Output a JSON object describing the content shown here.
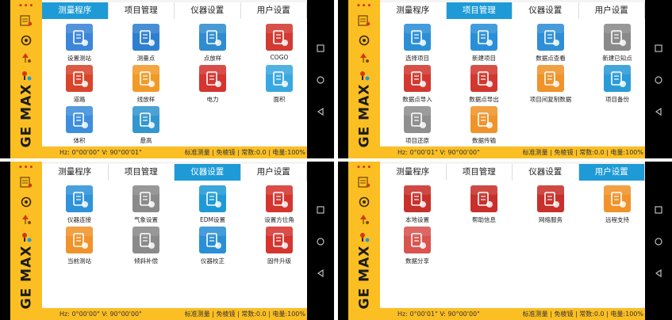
{
  "colors": {
    "accent": "#1e9bd7",
    "sidebar": "#fbbf24",
    "statusbar": "#fbbf24"
  },
  "sidebar": {
    "dots": "•••",
    "logo": "GE MAX"
  },
  "tabs": [
    "测量程序",
    "项目管理",
    "仪器设置",
    "用户设置"
  ],
  "status": {
    "right": "标准测量 | 免棱镜 | 常数:0.0 | 电量:100%",
    "hz_v_a": "Hz: 0°00'00\"  V: 90°00'01\"",
    "hz_v_b": "Hz: 0°00'01\"  V: 90°00'00\"",
    "hz_v_c": "Hz: 0°00'00\"  V: 90°00'00\"",
    "hz_v_d": "Hz: 0°00'01\"  V: 90°00'00\""
  },
  "panels": [
    {
      "active_tab": 0,
      "items": [
        {
          "label": "设置测站",
          "icon": "station-setup-icon",
          "color": "#3b86d8"
        },
        {
          "label": "测量点",
          "icon": "measure-point-icon",
          "color": "#2f7fd0"
        },
        {
          "label": "点放样",
          "icon": "point-stakeout-icon",
          "color": "#2f8ccf"
        },
        {
          "label": "COGO",
          "icon": "cogo-icon",
          "color": "#d23a32"
        },
        {
          "label": "道路",
          "icon": "road-icon",
          "color": "#d8452b"
        },
        {
          "label": "线放样",
          "icon": "line-stakeout-icon",
          "color": "#f29a27"
        },
        {
          "label": "电力",
          "icon": "power-icon",
          "color": "#d5342f"
        },
        {
          "label": "面积",
          "icon": "area-icon",
          "color": "#39a7e0"
        },
        {
          "label": "体积",
          "icon": "volume-icon",
          "color": "#3d8edb"
        },
        {
          "label": "悬高",
          "icon": "remote-height-icon",
          "color": "#3396cf"
        }
      ]
    },
    {
      "active_tab": 1,
      "items": [
        {
          "label": "选择项目",
          "icon": "select-project-icon",
          "color": "#2b8fd6"
        },
        {
          "label": "新建项目",
          "icon": "new-project-icon",
          "color": "#2a8fd8"
        },
        {
          "label": "数据点查看",
          "icon": "view-points-icon",
          "color": "#2e8ed6"
        },
        {
          "label": "新建已知点",
          "icon": "new-known-point-icon",
          "color": "#8a8a8a"
        },
        {
          "label": "数据点导入",
          "icon": "import-points-icon",
          "color": "#d2382f"
        },
        {
          "label": "数据点导出",
          "icon": "export-points-icon",
          "color": "#d2382f"
        },
        {
          "label": "项目间复制数据",
          "icon": "copy-data-icon",
          "color": "#f0932a"
        },
        {
          "label": "项目备份",
          "icon": "project-backup-icon",
          "color": "#2b9bd8"
        },
        {
          "label": "项目还原",
          "icon": "project-restore-icon",
          "color": "#8f8f8f"
        },
        {
          "label": "数据传输",
          "icon": "data-transfer-icon",
          "color": "#f0932a"
        }
      ]
    },
    {
      "active_tab": 2,
      "items": [
        {
          "label": "仪器连接",
          "icon": "instrument-connect-icon",
          "color": "#2e93d8"
        },
        {
          "label": "气象设置",
          "icon": "weather-settings-icon",
          "color": "#8a8a8a"
        },
        {
          "label": "EDM设置",
          "icon": "edm-settings-icon",
          "color": "#1f9ad6"
        },
        {
          "label": "设置方位角",
          "icon": "azimuth-icon",
          "color": "#d5352f"
        },
        {
          "label": "当前测站",
          "icon": "current-station-icon",
          "color": "#f0932a"
        },
        {
          "label": "倾斜补偿",
          "icon": "tilt-compensation-icon",
          "color": "#8a8a8a"
        },
        {
          "label": "仪器校正",
          "icon": "calibration-icon",
          "color": "#2b8fd6"
        },
        {
          "label": "固件升级",
          "icon": "firmware-upgrade-icon",
          "color": "#d5352f"
        }
      ]
    },
    {
      "active_tab": 3,
      "items": [
        {
          "label": "本地设置",
          "icon": "local-settings-icon",
          "color": "#c8302b"
        },
        {
          "label": "帮助信息",
          "icon": "help-info-icon",
          "color": "#c8302b"
        },
        {
          "label": "网络服务",
          "icon": "network-service-icon",
          "color": "#c8302b"
        },
        {
          "label": "远程支持",
          "icon": "remote-support-icon",
          "color": "#f0932a"
        },
        {
          "label": "数据分享",
          "icon": "data-share-icon",
          "color": "#d9534f"
        }
      ]
    }
  ]
}
